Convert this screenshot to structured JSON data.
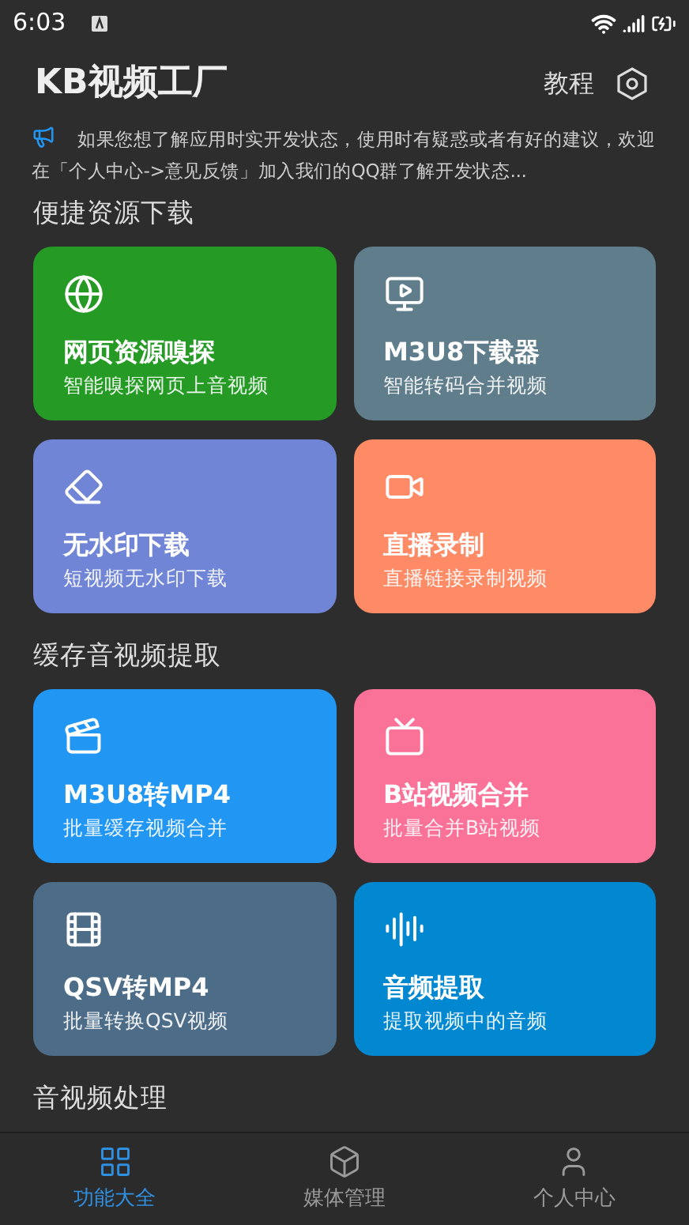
{
  "status_bar": {
    "time": "6:03"
  },
  "header": {
    "title": "KB视频工厂",
    "tutorial": "教程"
  },
  "notice": "如果您想了解应用时实开发状态，使用时有疑惑或者有好的建议，欢迎在「个人中心->意见反馈」加入我们的QQ群了解开发状态...",
  "sections": [
    {
      "title": "便捷资源下载",
      "cards": [
        {
          "kind": "globe",
          "title": "网页资源嗅探",
          "subtitle": "智能嗅探网页上音视频",
          "color": "#259b26"
        },
        {
          "kind": "download-video",
          "title": "M3U8下载器",
          "subtitle": "智能转码合并视频",
          "color": "#5f7d8b"
        },
        {
          "kind": "eraser",
          "title": "无水印下载",
          "subtitle": "短视频无水印下载",
          "color": "#7185d6"
        },
        {
          "kind": "camera",
          "title": "直播录制",
          "subtitle": "直播链接录制视频",
          "color": "#fe8b65"
        }
      ]
    },
    {
      "title": "缓存音视频提取",
      "cards": [
        {
          "kind": "clapper",
          "title": "M3U8转MP4",
          "subtitle": "批量缓存视频合并",
          "color": "#2196f3"
        },
        {
          "kind": "tv",
          "title": "B站视频合并",
          "subtitle": "批量合并B站视频",
          "color": "#fb7299"
        },
        {
          "kind": "film",
          "title": "QSV转MP4",
          "subtitle": "批量转换QSV视频",
          "color": "#4d6c87"
        },
        {
          "kind": "audio",
          "title": "音频提取",
          "subtitle": "提取视频中的音频",
          "color": "#0288d1"
        }
      ]
    },
    {
      "title": "音视频处理"
    }
  ],
  "nav": [
    {
      "kind": "grid",
      "label": "功能大全",
      "selected": true
    },
    {
      "kind": "box",
      "label": "媒体管理",
      "selected": false
    },
    {
      "kind": "user",
      "label": "个人中心",
      "selected": false
    }
  ]
}
